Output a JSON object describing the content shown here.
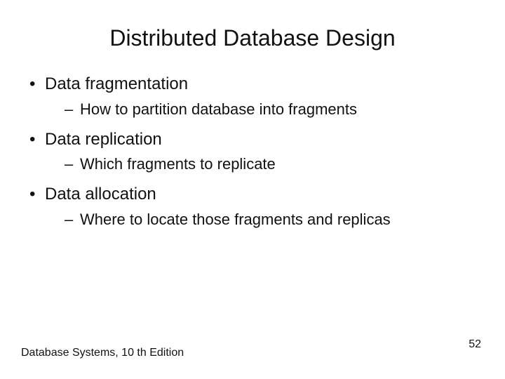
{
  "slide": {
    "title": "Distributed Database Design",
    "bullets": [
      {
        "level": 1,
        "text": "Data fragmentation"
      },
      {
        "level": 2,
        "text": "How to partition database into fragments"
      },
      {
        "level": 1,
        "text": "Data replication"
      },
      {
        "level": 2,
        "text": "Which fragments to replicate"
      },
      {
        "level": 1,
        "text": "Data allocation"
      },
      {
        "level": 2,
        "text": "Where to locate those fragments and replicas"
      }
    ],
    "footer_left": "Database Systems, 10 th Edition",
    "page_number": "52"
  }
}
